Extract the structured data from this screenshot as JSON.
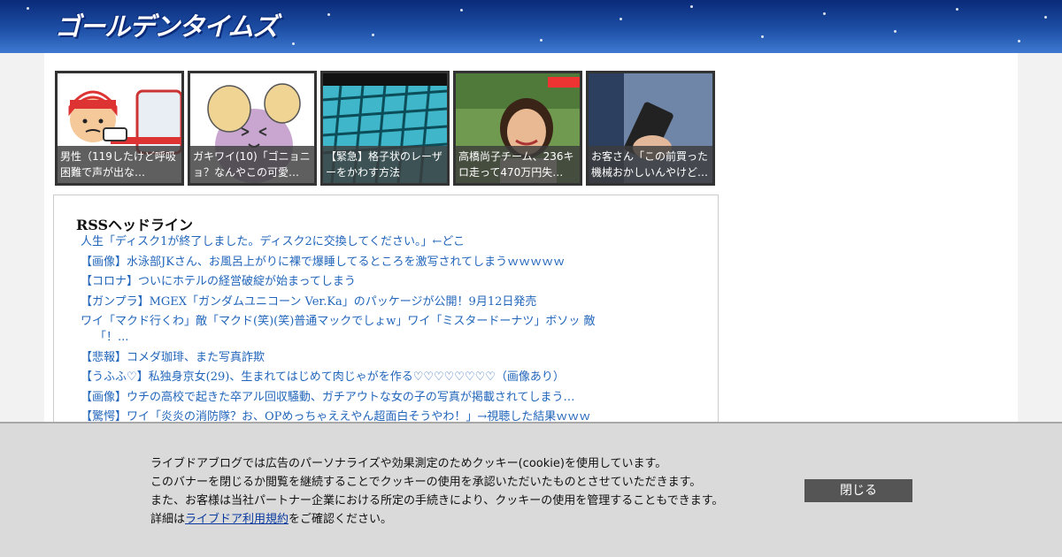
{
  "header": {
    "logo_text": "ゴールデンタイムズ"
  },
  "thumbnails": [
    {
      "caption": "男性（119したけど呼吸困難で声が出な…"
    },
    {
      "caption": "ガキワイ(10)「ゴニョニョ？なんやこの可愛…"
    },
    {
      "caption": "【緊急】格子状のレーザーをかわす方法"
    },
    {
      "caption": "高橋尚子チーム、236キロ走って470万円失…"
    },
    {
      "caption": "お客さん「この前買った機械おかしいんやけど…"
    }
  ],
  "rss": {
    "title": "RSSヘッドライン",
    "items": [
      "人生「ディスク1が終了しました。ディスク2に交換してください。」←どこ",
      "【画像】水泳部JKさん、お風呂上がりに裸で爆睡してるところを激写されてしまうｗｗｗｗｗ",
      "【コロナ】ついにホテルの経営破綻が始まってしまう",
      "【ガンプラ】MGEX「ガンダムユニコーン Ver.Ka」のパッケージが公開！9月12日発売",
      "ワイ「マクド行くわ」敵「マクド(笑)(笑)普通マックでしょw」ワイ「ミスタードーナツ」ボソッ 敵「！...",
      "【悲報】コメダ珈琲、また写真詐欺",
      "【うふふ♡】私独身京女(29)、生まれてはじめて肉じゃがを作る♡♡♡♡♡♡♡♡（画像あり）",
      "【画像】ウチの高校で起きた卒アル回収騒動、ガチアウトな女の子の写真が掲載されてしまう…",
      "【驚愕】ワイ「炎炎の消防隊？お、OPめっちゃええやん超面白そうやわ！」→視聴した結果ｗｗｗ"
    ]
  },
  "cookie_banner": {
    "line1": "ライブドアブログでは広告のパーソナライズや効果測定のためクッキー(cookie)を使用しています。",
    "line2": "このバナーを閉じるか閲覧を継続することでクッキーの使用を承認いただいたものとさせていただきます。",
    "line3": "また、お客様は当社パートナー企業における所定の手続きにより、クッキーの使用を管理することもできます。",
    "line4_prefix": "詳細は",
    "link_text": "ライブドア利用規約",
    "line4_suffix": "をご確認ください。",
    "close_label": "閉じる"
  }
}
